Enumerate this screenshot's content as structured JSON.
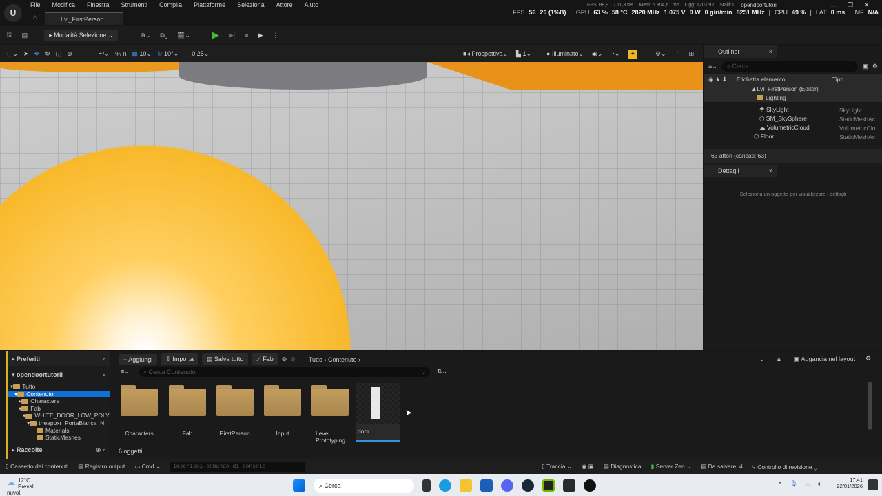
{
  "app": {
    "logo": "U",
    "tab": "Lvl_FirstPerson"
  },
  "menu": [
    "File",
    "Modifica",
    "Finestra",
    "Strumenti",
    "Compila",
    "Piattaforme",
    "Seleziona",
    "Attore",
    "Aiuto"
  ],
  "stats_small": {
    "fps": "FPS: 88,9",
    "ms": "/ 11,3 ms",
    "mem": "Mem: 5.304,61 mb",
    "ogg": "Ogg: 120.092",
    "stalli": "Stalli: 0"
  },
  "project_name": "opendoortutoril",
  "stats": [
    "FPS",
    "56",
    "20 (1%B)",
    "|",
    "GPU",
    "63 %",
    "58 °C",
    "2820 MHz",
    "1.075 V",
    "0 W",
    "0 giri/min",
    "8251 MHz",
    "|",
    "CPU",
    "49 %",
    "|",
    "LAT",
    "0 ms",
    "|",
    "MF",
    "N/A"
  ],
  "toolbar": {
    "mode": "Modalità Selezione"
  },
  "viewport_bar": {
    "snap_rot": "0",
    "grid": "10",
    "angle": "10°",
    "scale": "0,25",
    "view": "Prospettiva",
    "cam": "1",
    "lit": "Illuminato"
  },
  "outliner": {
    "title": "Outliner",
    "search_placeholder": "Cerca...",
    "col_label": "Etichetta elemento",
    "col_type": "Tipo",
    "rows": [
      {
        "name": "Lvl_FirstPerson (Editor)",
        "type": ""
      },
      {
        "name": "Lighting",
        "type": ""
      },
      {
        "name": "SkyLight",
        "type": "SkyLight"
      },
      {
        "name": "SM_SkySphere",
        "type": "StaticMeshAc"
      },
      {
        "name": "VolumetricCloud",
        "type": "VolumetricClo"
      },
      {
        "name": "Floor",
        "type": "StaticMeshAc"
      }
    ],
    "count": "63 attori (caricati: 63)"
  },
  "details": {
    "title": "Dettagli",
    "empty": "Seleziona un oggetto per visualizzare i dettagli"
  },
  "content": {
    "favorites": "Preferiti",
    "project": "opendoortutoril",
    "collections": "Raccolte",
    "tree": [
      "Tutto",
      "Contenuto",
      "Characters",
      "Fab",
      "WHITE_DOOR_LOW_POLY",
      "theappxr_PortaBianca_N",
      "Materials",
      "StaticMeshes"
    ],
    "add": "Aggiungi",
    "import": "Importa",
    "save_all": "Salva tutto",
    "fab": "Fab",
    "crumbs": [
      "Tutto",
      "Contenuto"
    ],
    "dock": "Aggancia nel layout",
    "search_placeholder": "Cerca Contenuto",
    "items": [
      "Characters",
      "Fab",
      "FirstPerson",
      "Input",
      "Level Prototyping",
      "door"
    ],
    "count": "6 oggetti"
  },
  "statusbar": {
    "drawer": "Cassetto dei contenuti",
    "log": "Registro output",
    "cmd": "Cmd",
    "cmd_placeholder": "Inserisci comando di console",
    "trace": "Traccia",
    "diag": "Diagnostica",
    "server": "Server Zen",
    "unsaved": "Da salvare: 4",
    "revision": "Controllo di revisione"
  },
  "taskbar": {
    "temp": "12°C",
    "weather": "Preval. nuvol.",
    "search": "Cerca",
    "time": "17:41",
    "date": "22/01/2026"
  }
}
